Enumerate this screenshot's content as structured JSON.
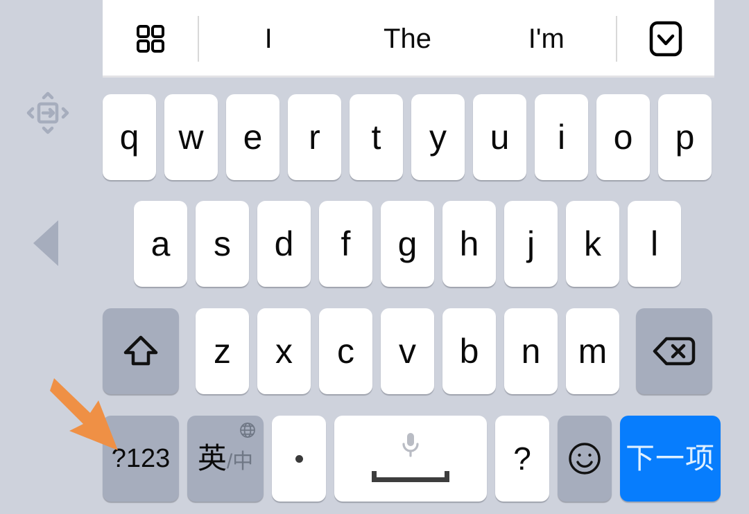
{
  "theme": {
    "background": "#ced2dc",
    "key_white": "#ffffff",
    "key_modifier_gray": "#a6adbd",
    "accent_blue": "#077dfd",
    "annotation_orange": "#ef9045",
    "text_dark": "#0a0a0a",
    "text_muted": "#6f7785"
  },
  "left_rail": {
    "move_handle": "move-handle-icon",
    "back_caret": "back-caret-icon"
  },
  "suggestion_bar": {
    "grid_icon": "grid-icon",
    "suggestions": [
      "I",
      "The",
      "I'm"
    ],
    "hide_keyboard_icon": "chevron-down-icon"
  },
  "keyboard": {
    "rows": [
      {
        "name": "row-1",
        "keys": [
          "q",
          "w",
          "e",
          "r",
          "t",
          "y",
          "u",
          "i",
          "o",
          "p"
        ]
      },
      {
        "name": "row-2",
        "keys": [
          "a",
          "s",
          "d",
          "f",
          "g",
          "h",
          "j",
          "k",
          "l"
        ]
      },
      {
        "name": "row-3",
        "keys": [
          "z",
          "x",
          "c",
          "v",
          "b",
          "n",
          "m"
        ]
      }
    ],
    "shift_key": {
      "icon": "shift-arrow-icon",
      "label": ""
    },
    "backspace_key": {
      "icon": "backspace-delete-icon",
      "label": ""
    },
    "bottom_row": {
      "numeric_key": "?123",
      "language_key": {
        "primary": "英",
        "separator": "/",
        "secondary": "中",
        "icon": "globe-icon"
      },
      "period_key": ".",
      "space_key": {
        "icon": "microphone-icon",
        "glyph": "space-bar-glyph",
        "label": ""
      },
      "question_key": "?",
      "emoji_key": {
        "icon": "smiley-face-icon",
        "label": ""
      },
      "next_key": "下一项"
    }
  },
  "annotation": {
    "arrow": "orange-pointer-arrow",
    "points_at": "?123"
  }
}
